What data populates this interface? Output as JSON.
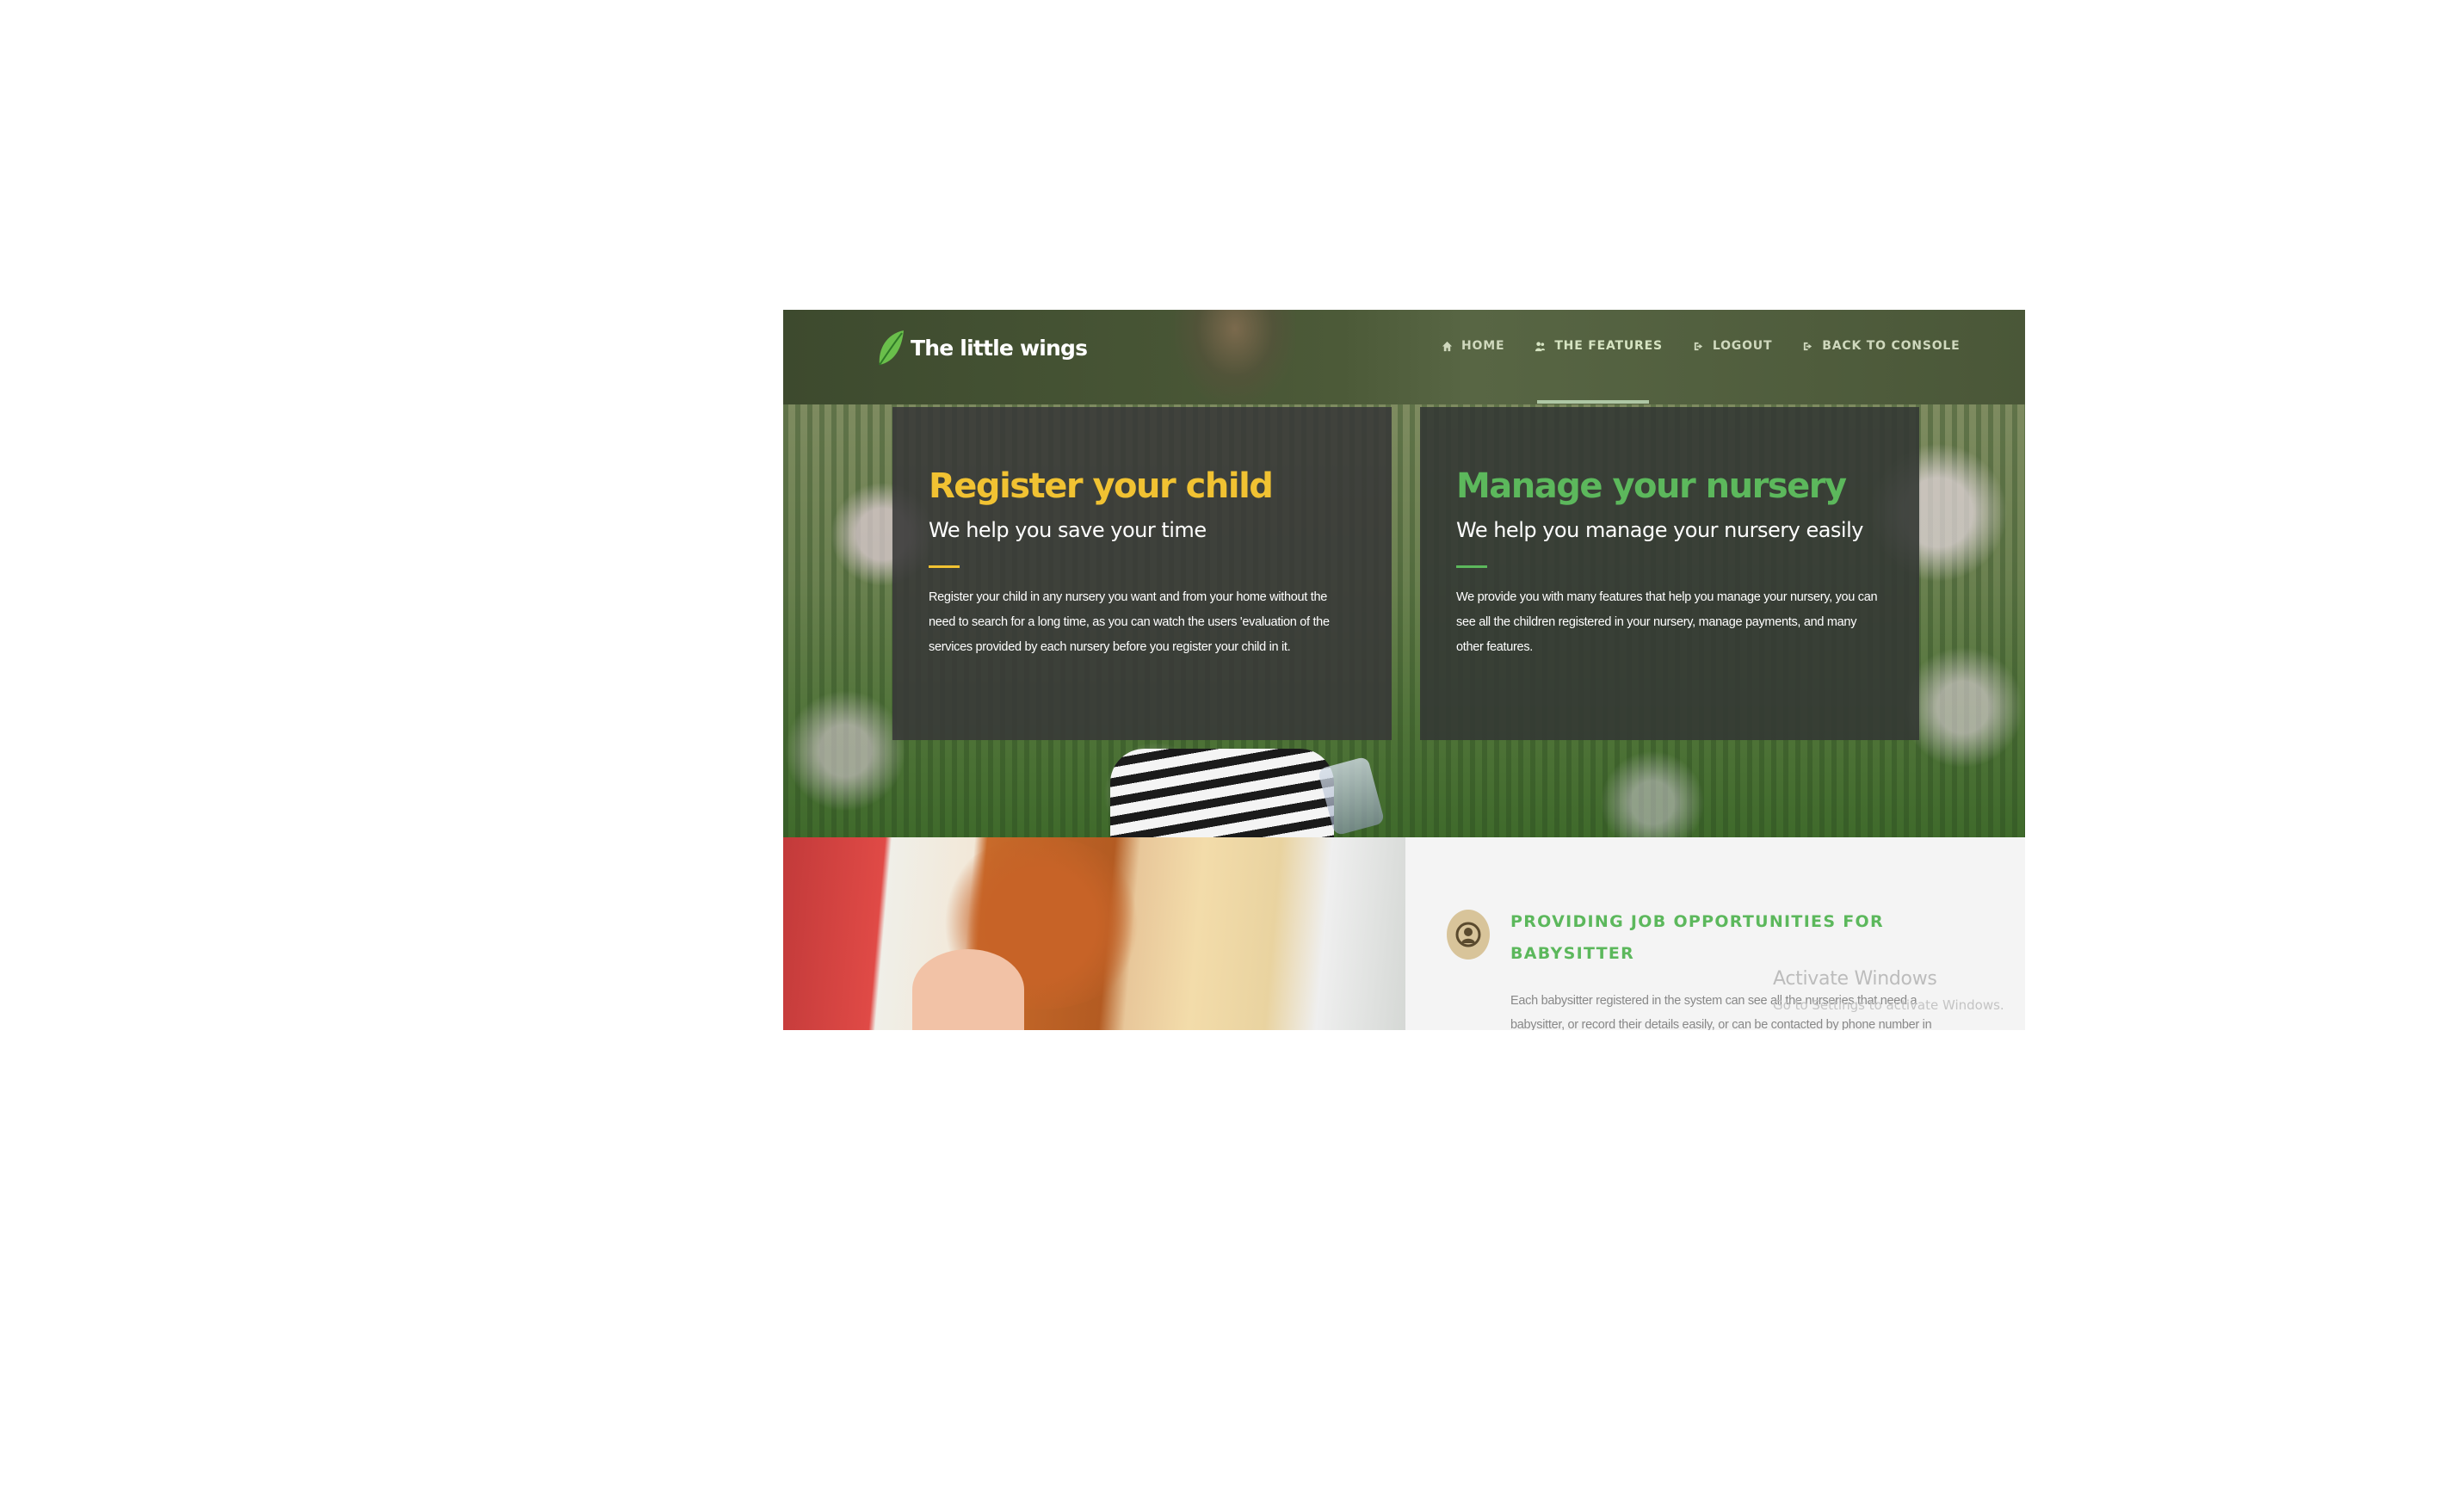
{
  "header": {
    "brand": "The little wings",
    "nav": [
      {
        "label": "HOME",
        "icon": "home-icon"
      },
      {
        "label": "THE FEATURES",
        "icon": "users-icon",
        "active": true
      },
      {
        "label": "LOGOUT",
        "icon": "logout-icon"
      },
      {
        "label": "BACK TO CONSOLE",
        "icon": "logout-icon"
      }
    ]
  },
  "hero": {
    "cards": [
      {
        "title": "Register your child",
        "subtitle": "We help you save your time",
        "body": "Register your child in any nursery you want and from your home without the need to search for a long time, as you can watch the users 'evaluation of the services provided by each nursery before you register your child in it.",
        "accent": "#f1c232"
      },
      {
        "title": "Manage your nursery",
        "subtitle": "We help you manage your nursery easily",
        "body": "We provide you with many features that help you manage your nursery, you can see all the children registered in your nursery, manage payments, and many other features.",
        "accent": "#5cb85c"
      }
    ]
  },
  "feature": {
    "icon": "babysitter-icon",
    "title": "PROVIDING JOB OPPORTUNITIES FOR BABYSITTER",
    "body": "Each babysitter registered in the system can see all the nurseries that need a babysitter, or record their details easily, or can be contacted by phone number in"
  },
  "watermark": {
    "title": "Activate Windows",
    "subtitle": "Go to Settings to activate Windows."
  }
}
